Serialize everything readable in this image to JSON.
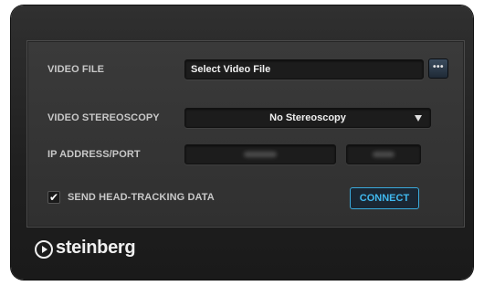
{
  "window": {
    "fields": {
      "video_file_label": "VIDEO FILE",
      "video_file_value": "Select Video File",
      "more_button_label": "•••",
      "stereoscopy_label": "VIDEO STEREOSCOPY",
      "stereoscopy_value": "No Stereoscopy",
      "ip_label": "IP ADDRESS/PORT"
    },
    "headtracking": {
      "checkbox_mark": "✔",
      "label": "SEND HEAD-TRACKING DATA",
      "checked": true
    },
    "connect_button_label": "CONNECT",
    "brand": {
      "logo_text": "steinberg"
    }
  },
  "colors": {
    "accent": "#40b8ee",
    "panel_bg": "#333333",
    "window_bg": "#222222"
  },
  "icons": {
    "more": "ellipsis-icon",
    "dropdown": "triangle-down-icon",
    "logo": "play-circle-icon"
  }
}
